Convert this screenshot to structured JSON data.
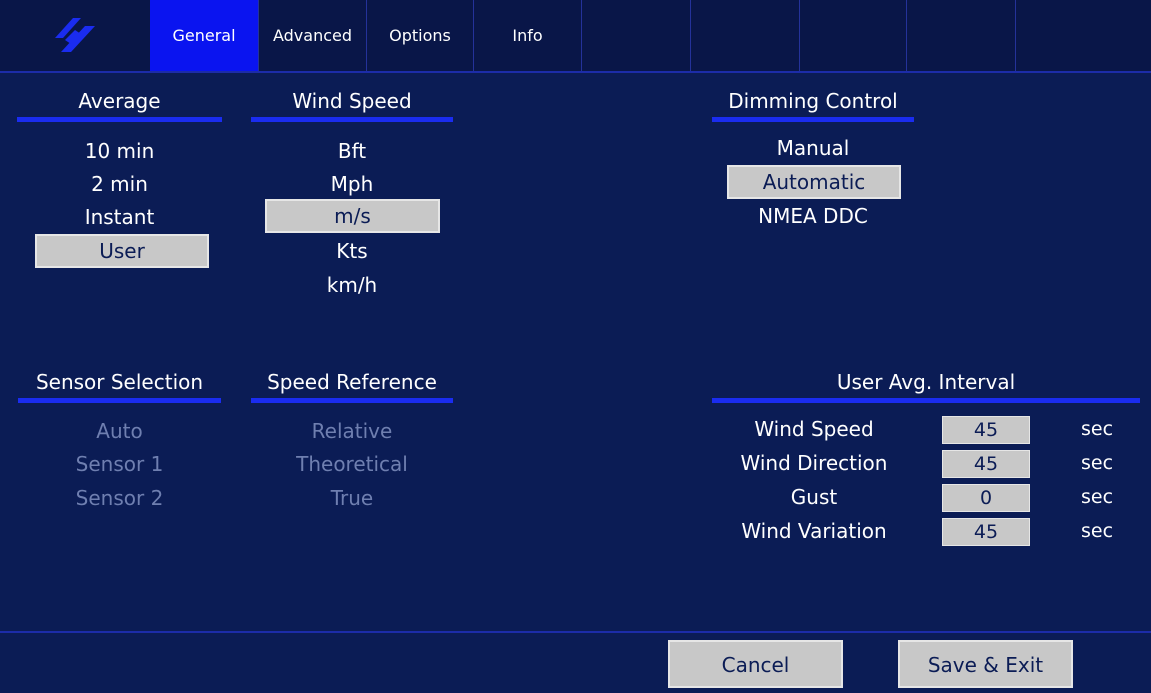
{
  "tabs": [
    {
      "label": "General",
      "active": true
    },
    {
      "label": "Advanced",
      "active": false
    },
    {
      "label": "Options",
      "active": false
    },
    {
      "label": "Info",
      "active": false
    }
  ],
  "average": {
    "title": "Average",
    "options": [
      "10 min",
      "2 min",
      "Instant",
      "User"
    ],
    "selected": "User"
  },
  "wind_speed": {
    "title": "Wind Speed",
    "options": [
      "Bft",
      "Mph",
      "m/s",
      "Kts",
      "km/h"
    ],
    "selected": "m/s"
  },
  "dimming": {
    "title": "Dimming Control",
    "options": [
      "Manual",
      "Automatic",
      "NMEA DDC"
    ],
    "selected": "Automatic"
  },
  "sensor_selection": {
    "title": "Sensor Selection",
    "options": [
      "Auto",
      "Sensor 1",
      "Sensor 2"
    ],
    "enabled": false
  },
  "speed_reference": {
    "title": "Speed Reference",
    "options": [
      "Relative",
      "Theoretical",
      "True"
    ],
    "enabled": false
  },
  "user_avg": {
    "title": "User Avg. Interval",
    "rows": [
      {
        "label": "Wind Speed",
        "value": "45",
        "unit": "sec"
      },
      {
        "label": "Wind Direction",
        "value": "45",
        "unit": "sec"
      },
      {
        "label": "Gust",
        "value": "0",
        "unit": "sec"
      },
      {
        "label": "Wind Variation",
        "value": "45",
        "unit": "sec"
      }
    ]
  },
  "buttons": {
    "cancel": "Cancel",
    "save": "Save & Exit"
  },
  "colors": {
    "background": "#0b1c55",
    "accent": "#1a2cf0",
    "selected_bg": "#c8c8c8",
    "disabled_text": "#6f7fb0"
  },
  "icons": {
    "logo": "brand-logo-icon"
  }
}
